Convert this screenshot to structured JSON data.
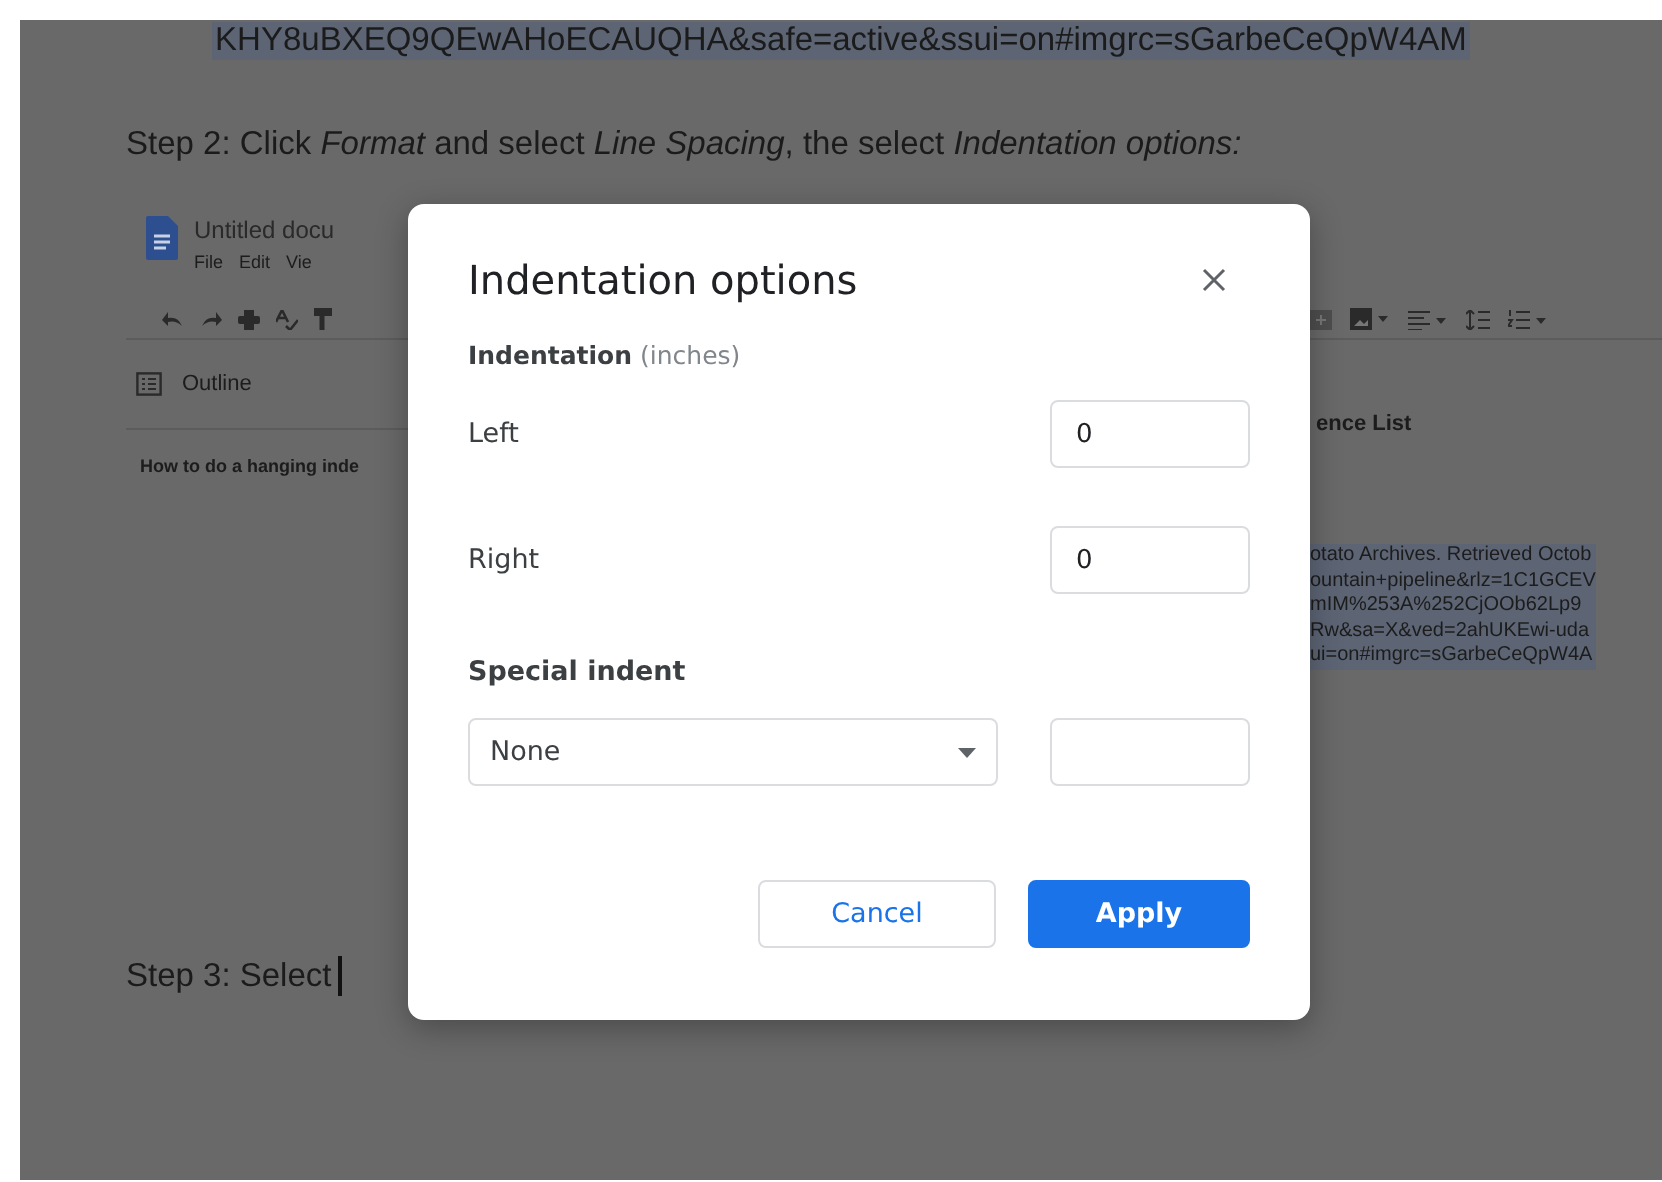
{
  "document": {
    "url": {
      "text": "KHY8uBXEQ9QEwAHoECAUQHA&safe=active&ssui=on#imgrc=sGarbeCeQpW4AM",
      "highlighted": true
    },
    "step_2": "Step 2: Click *Format* and select *Line Spacing*, the select *Indentation options:*",
    "step_3": "Step 3: Select"
  },
  "docs_screenshot": {
    "title": "Untitled docu",
    "menu": [
      "File",
      "Edit",
      "Vie"
    ],
    "outline_label": "Outline",
    "outline_item": "How to do a hanging inde",
    "heading": "ence List",
    "references": {
      "highlighted": true,
      "lines": [
        "otato Archives. Retrieved Octob",
        "ountain+pipeline&rlz=1C1GCEV",
        "mIM%253A%252CjOOb62Lp9",
        "Rw&sa=X&ved=2ahUKEwi-uda",
        "ui=on#imgrc=sGarbeCeQpW4A"
      ]
    }
  },
  "dialog": {
    "title": "Indentation options",
    "section_label": "Indentation",
    "section_unit": "(inches)",
    "fields": [
      {
        "label": "Left",
        "value": "0"
      },
      {
        "label": "Right",
        "value": "0"
      }
    ],
    "special_indent": {
      "label": "Special indent",
      "option": "None"
    },
    "buttons": [
      {
        "label": "Cancel",
        "kind": "secondary"
      },
      {
        "label": "Apply",
        "kind": "primary"
      }
    ]
  }
}
